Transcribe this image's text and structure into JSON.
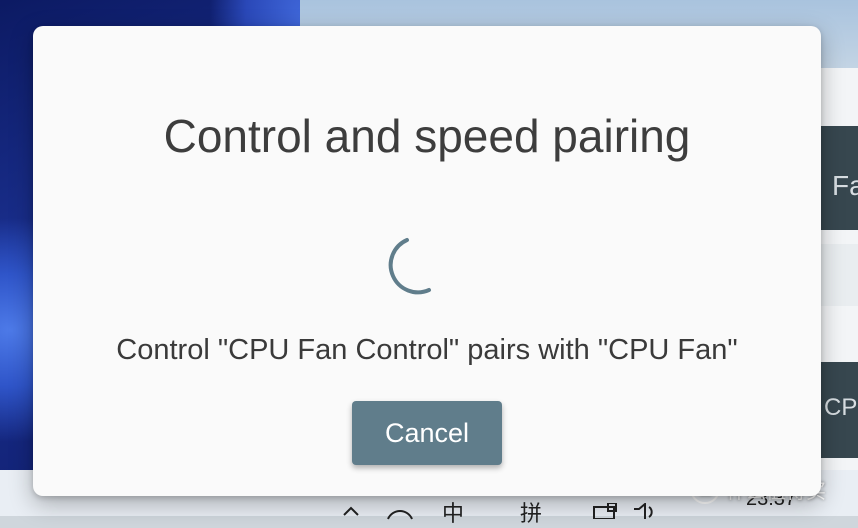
{
  "dialog": {
    "title": "Control and speed pairing",
    "message": "Control \"CPU Fan Control\" pairs with \"CPU Fan\"",
    "cancel_label": "Cancel",
    "spinner_icon": "loading-spinner-icon"
  },
  "background_app": {
    "card_top_text": "Fa",
    "card_bottom_text": "CP"
  },
  "taskbar": {
    "tray": {
      "chevron_icon": "chevron-up-icon",
      "ime_mode": "中",
      "ime_input": "拼",
      "network_icon": "network-icon",
      "volume_icon": "volume-icon"
    },
    "clock": "23:37"
  },
  "watermark": {
    "logo_text": "值",
    "text": "什么值得买"
  },
  "colors": {
    "dialog_bg": "#fafafa",
    "button_bg": "#607d8b",
    "spinner": "#607d8b",
    "app_card": "#37474f"
  }
}
